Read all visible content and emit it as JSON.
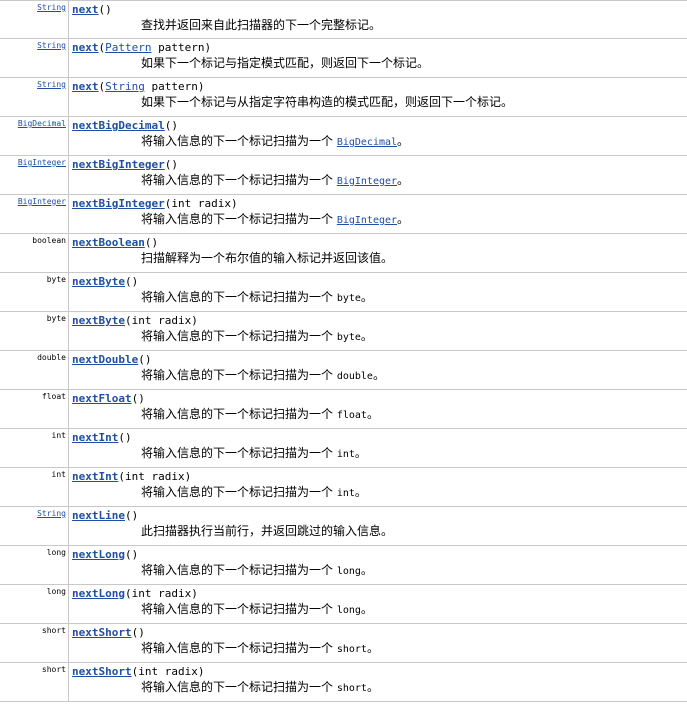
{
  "methods": [
    {
      "type": "String",
      "type_link": true,
      "name": "next",
      "pre": "(",
      "param_type": "",
      "param_link": false,
      "post": ")",
      "desc": "查找并返回来自此扫描器的下一个完整标记。",
      "ref": "",
      "ref_link": false,
      "tail": ""
    },
    {
      "type": "String",
      "type_link": true,
      "name": "next",
      "pre": "(",
      "param_type": "Pattern",
      "param_link": true,
      "post": " pattern)",
      "desc": "如果下一个标记与指定模式匹配，则返回下一个标记。",
      "ref": "",
      "ref_link": false,
      "tail": ""
    },
    {
      "type": "String",
      "type_link": true,
      "name": "next",
      "pre": "(",
      "param_type": "String",
      "param_link": true,
      "post": " pattern)",
      "desc": "如果下一个标记与从指定字符串构造的模式匹配，则返回下一个标记。",
      "ref": "",
      "ref_link": false,
      "tail": ""
    },
    {
      "type": "BigDecimal",
      "type_link": true,
      "name": "nextBigDecimal",
      "pre": "()",
      "param_type": "",
      "param_link": false,
      "post": "",
      "desc": "将输入信息的下一个标记扫描为一个 ",
      "ref": "BigDecimal",
      "ref_link": true,
      "tail": "。"
    },
    {
      "type": "BigInteger",
      "type_link": true,
      "name": "nextBigInteger",
      "pre": "()",
      "param_type": "",
      "param_link": false,
      "post": "",
      "desc": "将输入信息的下一个标记扫描为一个 ",
      "ref": "BigInteger",
      "ref_link": true,
      "tail": "。"
    },
    {
      "type": "BigInteger",
      "type_link": true,
      "name": "nextBigInteger",
      "pre": "(int radix)",
      "param_type": "",
      "param_link": false,
      "post": "",
      "desc": "将输入信息的下一个标记扫描为一个 ",
      "ref": "BigInteger",
      "ref_link": true,
      "tail": "。"
    },
    {
      "type": "boolean",
      "type_link": false,
      "name": "nextBoolean",
      "pre": "()",
      "param_type": "",
      "param_link": false,
      "post": "",
      "desc": "扫描解释为一个布尔值的输入标记并返回该值。",
      "ref": "",
      "ref_link": false,
      "tail": ""
    },
    {
      "type": "byte",
      "type_link": false,
      "name": "nextByte",
      "pre": "()",
      "param_type": "",
      "param_link": false,
      "post": "",
      "desc": "将输入信息的下一个标记扫描为一个 ",
      "ref": "byte",
      "ref_link": false,
      "tail": "。"
    },
    {
      "type": "byte",
      "type_link": false,
      "name": "nextByte",
      "pre": "(int radix)",
      "param_type": "",
      "param_link": false,
      "post": "",
      "desc": "将输入信息的下一个标记扫描为一个 ",
      "ref": "byte",
      "ref_link": false,
      "tail": "。"
    },
    {
      "type": "double",
      "type_link": false,
      "name": "nextDouble",
      "pre": "()",
      "param_type": "",
      "param_link": false,
      "post": "",
      "desc": "将输入信息的下一个标记扫描为一个 ",
      "ref": "double",
      "ref_link": false,
      "tail": "。"
    },
    {
      "type": "float",
      "type_link": false,
      "name": "nextFloat",
      "pre": "()",
      "param_type": "",
      "param_link": false,
      "post": "",
      "desc": "将输入信息的下一个标记扫描为一个 ",
      "ref": "float",
      "ref_link": false,
      "tail": "。"
    },
    {
      "type": "int",
      "type_link": false,
      "name": "nextInt",
      "pre": "()",
      "param_type": "",
      "param_link": false,
      "post": "",
      "desc": "将输入信息的下一个标记扫描为一个 ",
      "ref": "int",
      "ref_link": false,
      "tail": "。"
    },
    {
      "type": "int",
      "type_link": false,
      "name": "nextInt",
      "pre": "(int radix)",
      "param_type": "",
      "param_link": false,
      "post": "",
      "desc": "将输入信息的下一个标记扫描为一个 ",
      "ref": "int",
      "ref_link": false,
      "tail": "。"
    },
    {
      "type": "String",
      "type_link": true,
      "name": "nextLine",
      "pre": "()",
      "param_type": "",
      "param_link": false,
      "post": "",
      "desc": "此扫描器执行当前行，并返回跳过的输入信息。",
      "ref": "",
      "ref_link": false,
      "tail": ""
    },
    {
      "type": "long",
      "type_link": false,
      "name": "nextLong",
      "pre": "()",
      "param_type": "",
      "param_link": false,
      "post": "",
      "desc": "将输入信息的下一个标记扫描为一个 ",
      "ref": "long",
      "ref_link": false,
      "tail": "。"
    },
    {
      "type": "long",
      "type_link": false,
      "name": "nextLong",
      "pre": "(int radix)",
      "param_type": "",
      "param_link": false,
      "post": "",
      "desc": "将输入信息的下一个标记扫描为一个 ",
      "ref": "long",
      "ref_link": false,
      "tail": "。"
    },
    {
      "type": "short",
      "type_link": false,
      "name": "nextShort",
      "pre": "()",
      "param_type": "",
      "param_link": false,
      "post": "",
      "desc": "将输入信息的下一个标记扫描为一个 ",
      "ref": "short",
      "ref_link": false,
      "tail": "。"
    },
    {
      "type": "short",
      "type_link": false,
      "name": "nextShort",
      "pre": "(int radix)",
      "param_type": "",
      "param_link": false,
      "post": "",
      "desc": "将输入信息的下一个标记扫描为一个 ",
      "ref": "short",
      "ref_link": false,
      "tail": "。"
    }
  ]
}
